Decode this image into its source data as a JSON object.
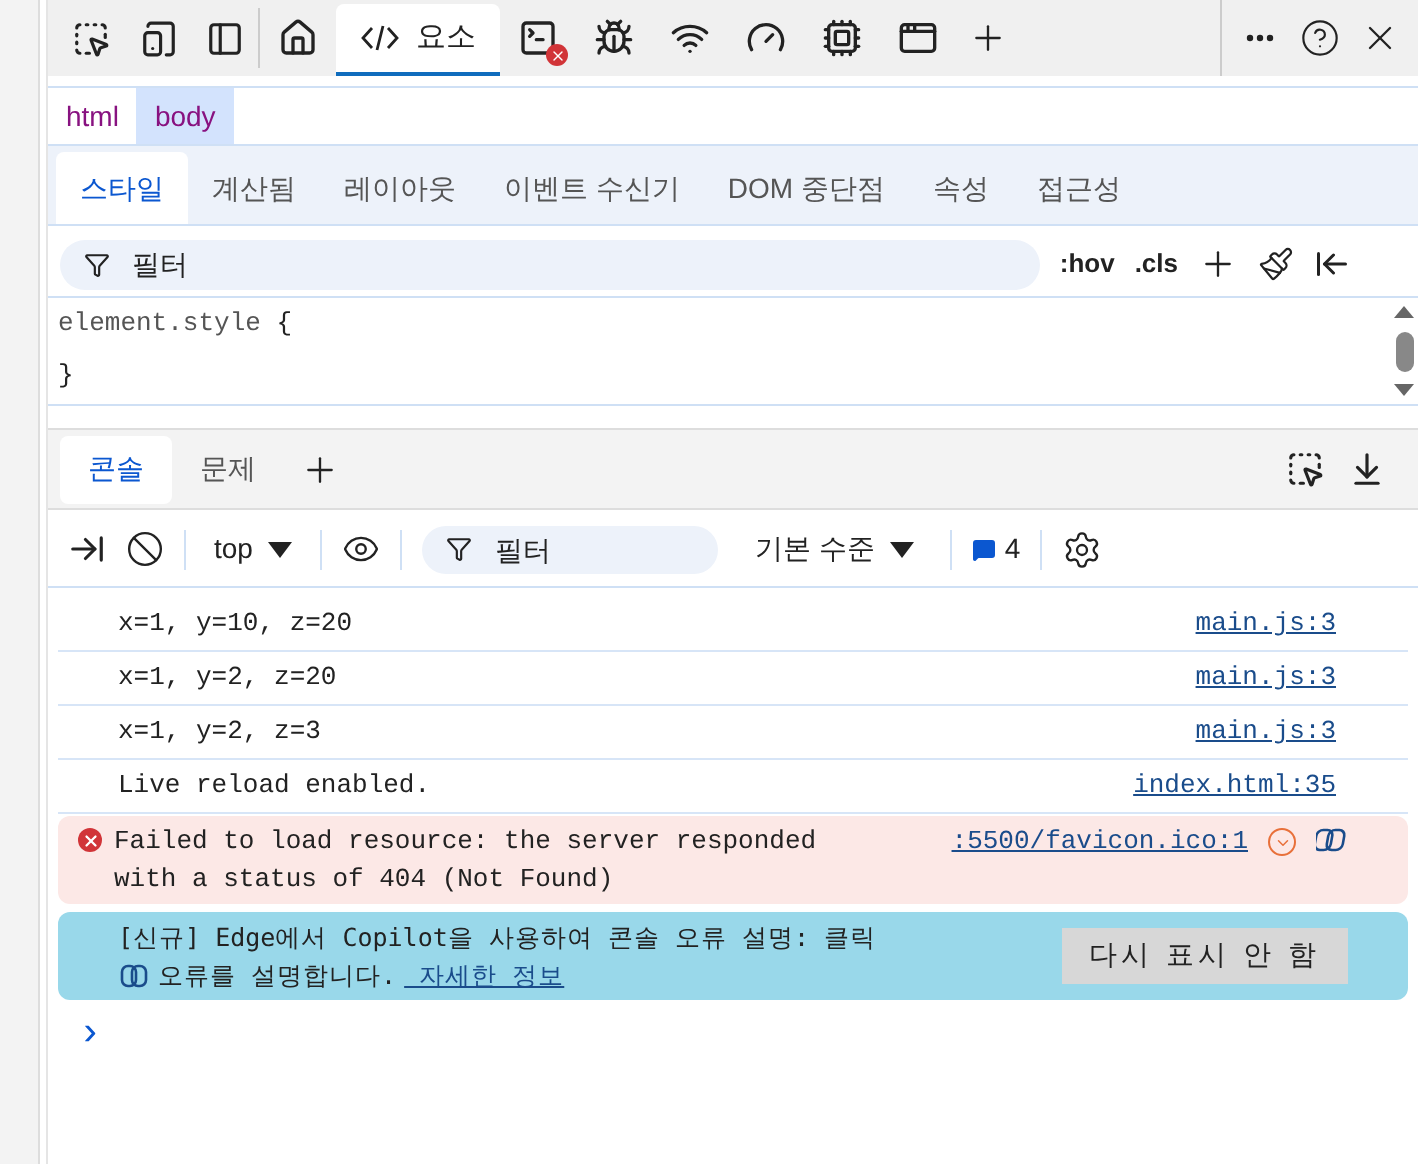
{
  "toolbar": {
    "tabs": [
      {
        "kind": "home",
        "selected": false
      },
      {
        "kind": "elements",
        "label": "요소",
        "selected": true
      },
      {
        "kind": "console",
        "selected": false,
        "error": true
      },
      {
        "kind": "bug",
        "selected": false
      },
      {
        "kind": "wifi",
        "selected": false
      },
      {
        "kind": "gauge",
        "selected": false
      },
      {
        "kind": "chip",
        "selected": false
      },
      {
        "kind": "window",
        "selected": false
      }
    ]
  },
  "breadcrumbs": [
    {
      "label": "html",
      "selected": false
    },
    {
      "label": "body",
      "selected": true
    }
  ],
  "styles_tabs": [
    {
      "label": "스타일",
      "selected": true
    },
    {
      "label": "계산됨",
      "selected": false
    },
    {
      "label": "레이아웃",
      "selected": false
    },
    {
      "label": "이벤트 수신기",
      "selected": false
    },
    {
      "label": "DOM 중단점",
      "selected": false
    },
    {
      "label": "속성",
      "selected": false
    },
    {
      "label": "접근성",
      "selected": false
    }
  ],
  "styles_filter": {
    "placeholder": "필터",
    "hov": ":hov",
    "cls": ".cls"
  },
  "rule": {
    "selector": "element.style",
    "open": "{",
    "close": "}"
  },
  "drawer_tabs": [
    {
      "label": "콘솔",
      "selected": true
    },
    {
      "label": "문제",
      "selected": false
    }
  ],
  "console_toolbar": {
    "context": "top",
    "filter_placeholder": "필터",
    "level": "기본 수준",
    "message_count": "4"
  },
  "messages": [
    {
      "kind": "log",
      "text": "x=1, y=10, z=20",
      "source": "main.js:3"
    },
    {
      "kind": "log",
      "text": "x=1, y=2, z=20",
      "source": "main.js:3"
    },
    {
      "kind": "log",
      "text": "x=1, y=2, z=3",
      "source": "main.js:3"
    },
    {
      "kind": "log",
      "text": "Live reload enabled.",
      "source": "index.html:35"
    },
    {
      "kind": "error",
      "text": "Failed to load resource: the server responded with a status of 404 (Not Found)",
      "source": ":5500/favicon.ico:1"
    }
  ],
  "banner": {
    "text": "[신규] Edge에서 Copilot을 사용하여 콘솔 오류 설명: 클릭",
    "text2": "오류를 설명합니다.",
    "link": " 자세한 정보",
    "button": "다시 표시 안 함"
  },
  "prompt": "›"
}
